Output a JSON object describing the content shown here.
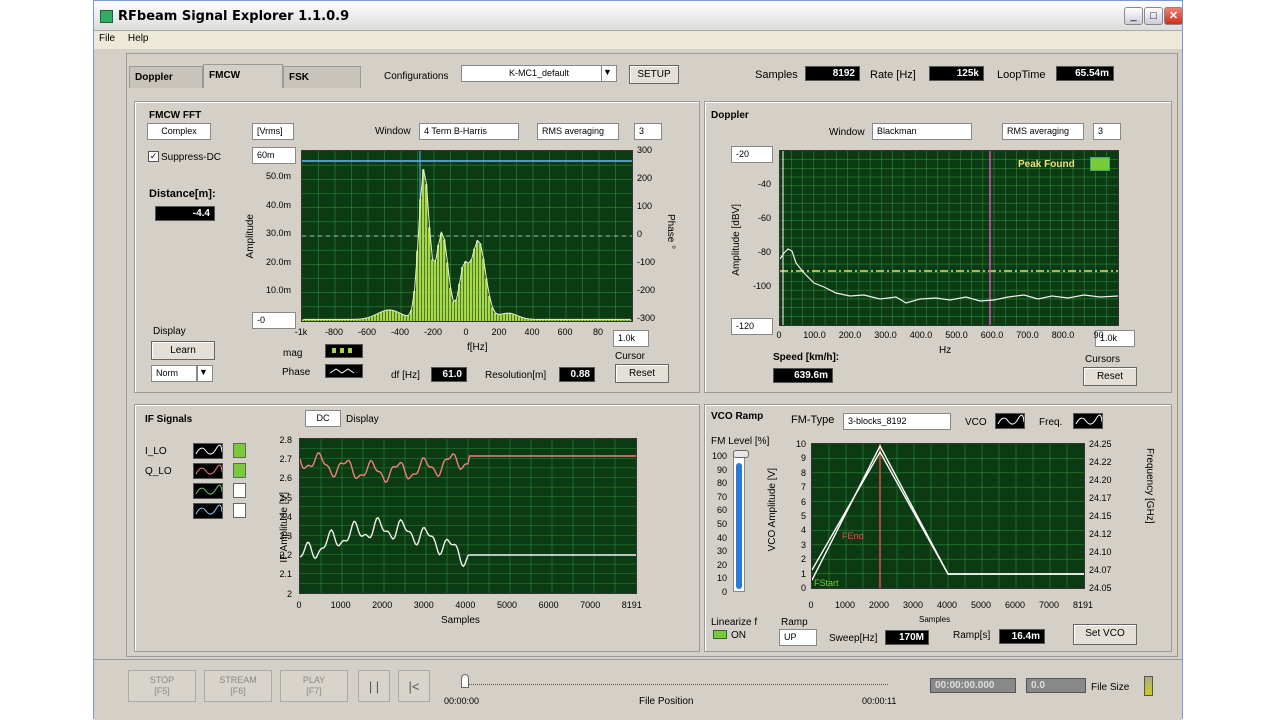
{
  "window": {
    "title": "RFbeam Signal Explorer 1.1.0.9",
    "minimize": "_",
    "maximize": "□",
    "close": "✕"
  },
  "menu": [
    "File",
    "Help"
  ],
  "tabs": [
    "Doppler",
    "FMCW",
    "FSK"
  ],
  "top": {
    "config_label": "Configurations",
    "config_value": "K-MC1_default",
    "setup": "SETUP",
    "samples_label": "Samples",
    "samples_value": "8192",
    "rate_label": "Rate [Hz]",
    "rate_value": "125k",
    "loop_label": "LoopTime",
    "loop_value": "65.54m"
  },
  "fmcw": {
    "title": "FMCW FFT",
    "complex": "Complex",
    "units": "[Vrms]",
    "window_label": "Window",
    "window_value": "4 Term B-Harris",
    "rms_label": "RMS averaging",
    "rms_value": "3",
    "suppress_dc": "Suppress-DC",
    "distance_label": "Distance[m]:",
    "distance_value": "-4.4",
    "ymax_ctrl": "60m",
    "ymin_ctrl": "-0",
    "xmax_ctrl": "1.0k",
    "y_ticks": [
      "50.0m",
      "40.0m",
      "30.0m",
      "20.0m",
      "10.0m"
    ],
    "y2_ticks": [
      "300",
      "200",
      "100",
      "0",
      "-100",
      "-200",
      "-300"
    ],
    "x_ticks": [
      "-1k",
      "-800",
      "-600",
      "-400",
      "-200",
      "0",
      "200",
      "400",
      "600",
      "80"
    ],
    "ylabel": "Amplitude",
    "y2label": "Phase °",
    "xlabel": "f[Hz]",
    "display_label": "Display",
    "learn": "Learn",
    "norm": "Norm",
    "mag_label": "mag",
    "phase_label": "Phase",
    "df_label": "df [Hz]",
    "df_value": "61.0",
    "res_label": "Resolution[m]",
    "res_value": "0.88",
    "cursor_label": "Cursor",
    "reset": "Reset"
  },
  "doppler": {
    "title": "Doppler",
    "window_label": "Window",
    "window_value": "Blackman",
    "rms_label": "RMS averaging",
    "rms_value": "3",
    "peak_found": "Peak Found",
    "ymax_ctrl": "-20",
    "ymin_ctrl": "-120",
    "xmax_ctrl": "1.0k",
    "y_ticks": [
      "-40",
      "-60",
      "-80",
      "-100"
    ],
    "x_ticks": [
      "0",
      "100.0",
      "200.0",
      "300.0",
      "400.0",
      "500.0",
      "600.0",
      "700.0",
      "800.0",
      "90"
    ],
    "ylabel": "Amplitude [dBV]",
    "xlabel": "Hz",
    "speed_label": "Speed [km/h]:",
    "speed_value": "639.6m",
    "cursors_label": "Cursors",
    "reset": "Reset"
  },
  "if": {
    "title": "IF Signals",
    "dc": "DC",
    "display": "Display",
    "legend": [
      "I_LO",
      "Q_LO"
    ],
    "y_ticks": [
      "2.8",
      "2.7",
      "2.6",
      "2.5",
      "2.4",
      "2.3",
      "2.2",
      "2.1",
      "2"
    ],
    "x_ticks": [
      "0",
      "1000",
      "2000",
      "3000",
      "4000",
      "5000",
      "6000",
      "7000",
      "8191"
    ],
    "ylabel": "IF Amplitude [V]",
    "xlabel": "Samples"
  },
  "vco": {
    "title": "VCO Ramp",
    "fm_type_label": "FM-Type",
    "fm_type_value": "3-blocks_8192",
    "vco_label": "VCO",
    "freq_label": "Freq.",
    "fm_level_label": "FM Level [%]",
    "fm_ticks": [
      "100",
      "90",
      "80",
      "70",
      "60",
      "50",
      "40",
      "30",
      "20",
      "10",
      "0"
    ],
    "y_ticks": [
      "10",
      "9",
      "8",
      "7",
      "6",
      "5",
      "4",
      "3",
      "2",
      "1",
      "0"
    ],
    "y2_ticks": [
      "24.25",
      "24.22",
      "24.20",
      "24.17",
      "24.15",
      "24.12",
      "24.10",
      "24.07",
      "24.05"
    ],
    "x_ticks": [
      "0",
      "1000",
      "2000",
      "3000",
      "4000",
      "5000",
      "6000",
      "7000",
      "8191"
    ],
    "ylabel": "VCO Amplitude [V]",
    "y2label": "Frequency [GHz]",
    "xlabel": "Samples",
    "fend": "FEnd",
    "fstart": "FStart",
    "linearize_label": "Linearize f",
    "linearize_value": "ON",
    "ramp_label": "Ramp",
    "ramp_value": "UP",
    "sweep_label": "Sweep[Hz]",
    "sweep_value": "170M",
    "rampt_label": "Ramp[s]",
    "rampt_value": "16.4m",
    "set_vco": "Set VCO"
  },
  "player": {
    "stop": "STOP",
    "stop_key": "[F5]",
    "stream": "STREAM",
    "stream_key": "[F6]",
    "play": "PLAY",
    "play_key": "[F7]",
    "pause": "| |",
    "rewind": "|<",
    "start_time": "00:00:00",
    "end_time": "00:00:11",
    "file_position": "File Position",
    "time_value": "00:00:00.000",
    "size_value": "0.0",
    "file_size": "File Size"
  },
  "colors": {
    "plot_bg": "#0c3a12",
    "grid": "#2a8a3a",
    "bar": "#a8d84a",
    "cursor": "#e050c0",
    "if_i": "#f08080",
    "if_q": "#f0f0f0",
    "peak": "#e8e080"
  }
}
